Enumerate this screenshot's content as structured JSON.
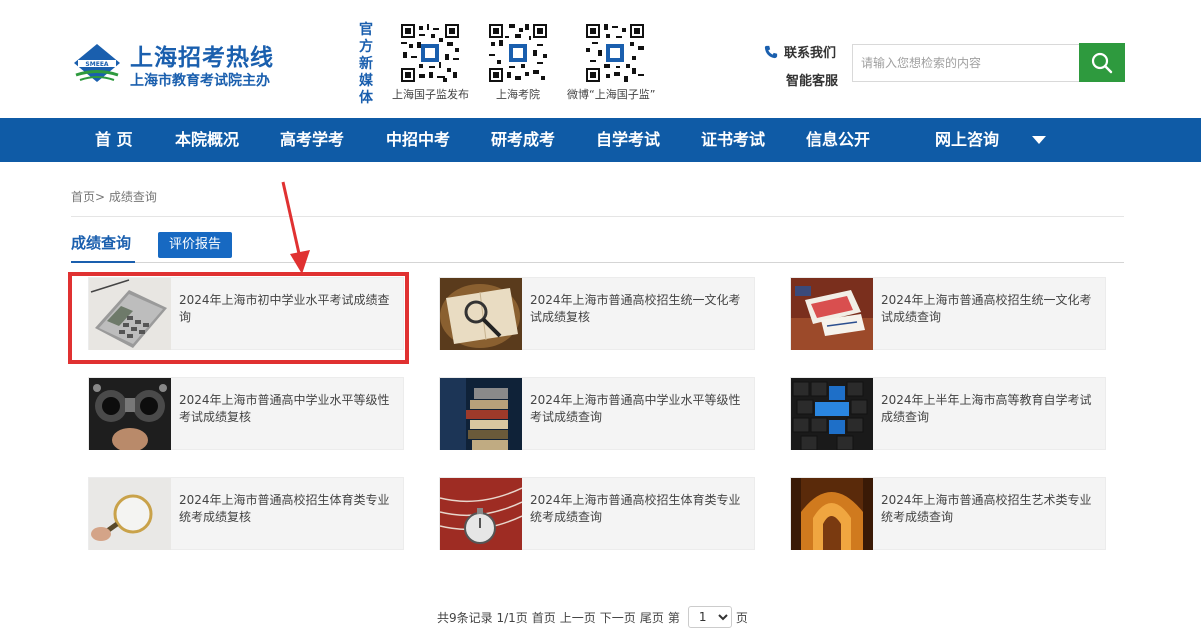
{
  "header": {
    "logo_title": "上海招考热线",
    "logo_sub": "上海市教育考试院主办",
    "logo_emblem_text": "SMEEA",
    "media_label": "官方新媒体",
    "qr_codes": [
      {
        "caption": "上海国子监发布"
      },
      {
        "caption": "上海考院"
      },
      {
        "caption": "微博“上海国子监”"
      }
    ],
    "contact_label": "联系我们",
    "service_label": "智能客服",
    "search_placeholder": "请输入您想检索的内容"
  },
  "nav": {
    "items": [
      "首 页",
      "本院概况",
      "高考学考",
      "中招中考",
      "研考成考",
      "自学考试",
      "证书考试",
      "信息公开",
      "网上咨询"
    ]
  },
  "breadcrumb": "首页> 成绩查询",
  "tabs": {
    "active": "成绩查询",
    "other": "评价报告"
  },
  "cards": [
    {
      "title": "2024年上海市初中学业水平考试成绩查询",
      "image": "calculator"
    },
    {
      "title": "2024年上海市普通高校招生统一文化考试成绩复核",
      "image": "magnifier-book"
    },
    {
      "title": "2024年上海市普通高校招生统一文化考试成绩查询",
      "image": "books-desk"
    },
    {
      "title": "2024年上海市普通高中学业水平等级性考试成绩复核",
      "image": "eye-test"
    },
    {
      "title": "2024年上海市普通高中学业水平等级性考试成绩查询",
      "image": "book-stack"
    },
    {
      "title": "2024年上半年上海市高等教育自学考试成绩查询",
      "image": "keyboard-quiz"
    },
    {
      "title": "2024年上海市普通高校招生体育类专业统考成绩复核",
      "image": "hand-magnifier"
    },
    {
      "title": "2024年上海市普通高校招生体育类专业统考成绩查询",
      "image": "stopwatch-track"
    },
    {
      "title": "2024年上海市普通高校招生艺术类专业统考成绩查询",
      "image": "arches"
    }
  ],
  "pager": {
    "summary": "共9条记录 1/1页",
    "first": "首页",
    "prev": "上一页",
    "next": "下一页",
    "last": "尾页",
    "go_prefix": "第",
    "current": "1",
    "go_suffix": "页"
  },
  "colors": {
    "brand_blue": "#0f5ba6",
    "accent_green": "#2e9a3e",
    "highlight_red": "#e03131"
  }
}
